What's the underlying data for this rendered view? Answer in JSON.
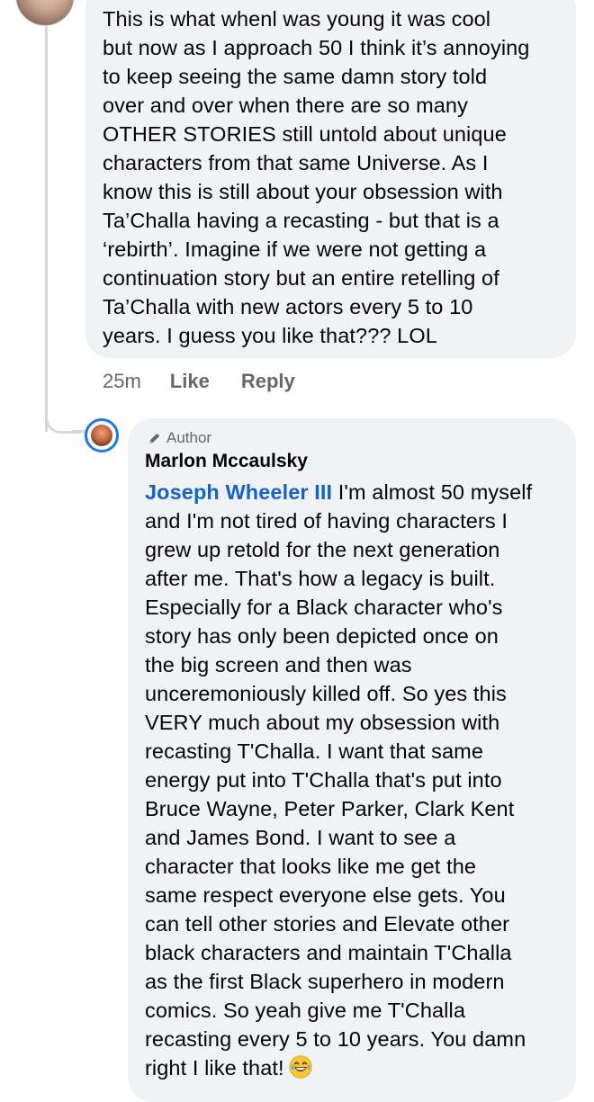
{
  "comment1": {
    "lines": [
      "This is what whenl was young it was cool",
      "but now as I approach 50 I think it’s annoying",
      "to keep seeing the same damn story told",
      "over and over when there are so many",
      "OTHER STORIES still untold about unique",
      "characters from that same Universe. As I",
      "know this is still about your obsession with",
      "Ta’Challa having a recasting - but that is a",
      "‘rebirth’. Imagine if we were not getting a",
      "continuation story but an entire retelling of",
      "Ta’Challa with new actors every 5 to 10",
      "years. I guess you like that??? LOL"
    ],
    "timestamp": "25m",
    "like_label": "Like",
    "reply_label": "Reply"
  },
  "comment2": {
    "badge": "Author",
    "author_name": "Marlon Mccaulsky",
    "mention": "Joseph Wheeler III",
    "first_line_rest": " I'm almost 50 myself",
    "lines": [
      "and I'm not tired of having characters I",
      "grew up retold for the next generation",
      "after me. That's how a legacy is built.",
      "Especially for a Black character who's",
      "story has only been depicted once on",
      "the big screen and then was",
      "unceremoniously killed off. So yes this",
      "VERY much about my obsession with",
      "recasting T'Challa. I want that same",
      "energy put into T'Challa that's put into",
      "Bruce Wayne, Peter Parker, Clark Kent",
      "and James Bond. I want to see a",
      "character that looks like me get the",
      "same respect everyone else gets. You",
      "can tell other stories and Elevate other",
      "black characters and maintain T'Challa",
      "as the first Black superhero in modern",
      "comics. So yeah give me T'Challa",
      "recasting every 5 to 10 years. You damn"
    ],
    "last_line": "right I like that!",
    "emoji": "laughing-crying-emoji"
  },
  "colors": {
    "bubble": "#f0f2f5",
    "mention": "#1563c7",
    "secondary_text": "#65676b",
    "thread_line": "#d5d8dd",
    "author_ring": "#1877f2"
  }
}
